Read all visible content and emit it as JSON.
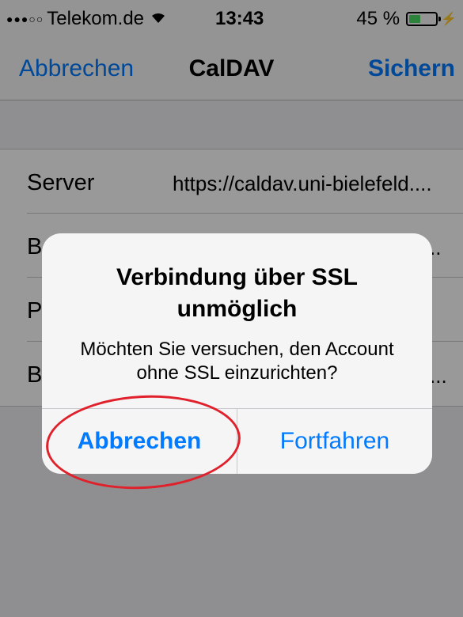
{
  "status_bar": {
    "signal": "●●●○○",
    "carrier": "Telekom.de",
    "time": "13:43",
    "battery_text": "45 %",
    "battery_level": 0.45,
    "bolt": "⚡"
  },
  "nav": {
    "left_label": "Abbrechen",
    "title": "CalDAV",
    "right_label": "Sichern"
  },
  "form": {
    "rows": [
      {
        "label": "Server",
        "value": "https://caldav.uni-bielefeld...."
      },
      {
        "label": "B",
        "value": ".."
      },
      {
        "label": "P",
        "value": ""
      },
      {
        "label": "B",
        "value": "..."
      }
    ]
  },
  "alert": {
    "title": "Verbindung über SSL unmöglich",
    "message": "Möchten Sie versuchen, den Account ohne SSL einzurichten?",
    "cancel_label": "Abbrechen",
    "continue_label": "Fortfahren"
  },
  "colors": {
    "accent": "#007aff",
    "highlight_marker": "#e0212b",
    "battery": "#4cd964"
  }
}
